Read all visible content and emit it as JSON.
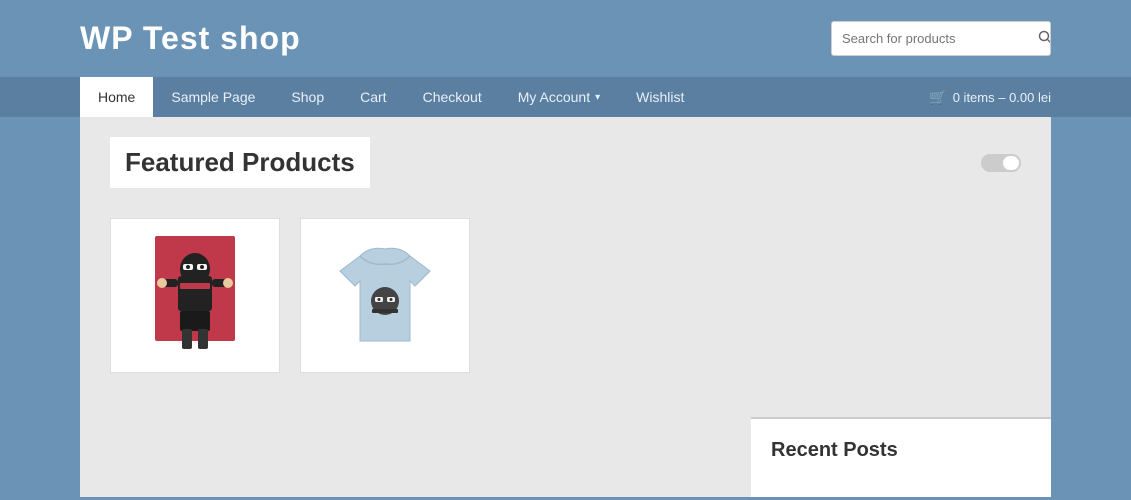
{
  "header": {
    "site_title": "WP Test shop",
    "search": {
      "placeholder": "Search for products",
      "button_label": "🔍"
    }
  },
  "nav": {
    "items": [
      {
        "label": "Home",
        "active": true
      },
      {
        "label": "Sample Page",
        "active": false
      },
      {
        "label": "Shop",
        "active": false
      },
      {
        "label": "Cart",
        "active": false
      },
      {
        "label": "Checkout",
        "active": false
      },
      {
        "label": "My Account",
        "active": false,
        "has_dropdown": true
      },
      {
        "label": "Wishlist",
        "active": false
      }
    ],
    "cart": {
      "icon": "🛒",
      "label": "0 items – 0.00 lei"
    }
  },
  "main": {
    "featured_title": "Featured Products",
    "products": [
      {
        "id": "product-1",
        "alt": "Ninja poster product",
        "type": "ninja-poster"
      },
      {
        "id": "product-2",
        "alt": "T-shirt product",
        "type": "tshirt"
      }
    ]
  },
  "sidebar": {
    "recent_posts_title": "Recent Posts"
  }
}
